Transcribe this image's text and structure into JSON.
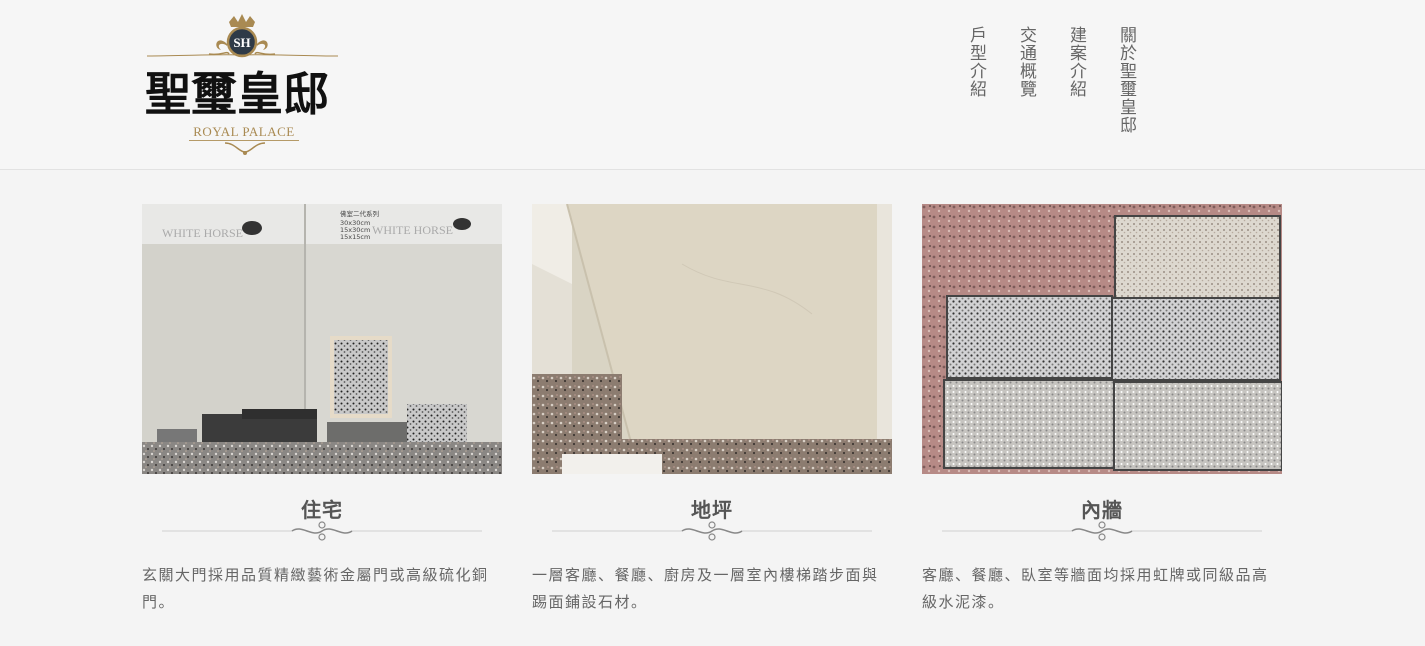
{
  "brand": {
    "monogram": "SH",
    "name": "聖璽皇邸",
    "subtitle": "ROYAL PALACE",
    "gold_color": "#a98a52"
  },
  "nav": [
    {
      "label": "戶型介紹"
    },
    {
      "label": "交通概覽"
    },
    {
      "label": "建案介紹"
    },
    {
      "label": "關於聖璽皇邸"
    }
  ],
  "cards": [
    {
      "title": "住宅",
      "description": "玄關大門採用品質精緻藝術金屬門或高級硫化銅門。",
      "photo_text": {
        "a": "WHITE HORSE",
        "b": "WHITE HORSE",
        "series": "佛室二代系列",
        "sizes": [
          "30x30cm",
          "15x30cm",
          "15x15cm"
        ]
      }
    },
    {
      "title": "地坪",
      "description": "一層客廳、餐廳、廚房及一層室內樓梯踏步面與踢面鋪設石材。"
    },
    {
      "title": "內牆",
      "description": "客廳、餐廳、臥室等牆面均採用虹牌或同級品高級水泥漆。"
    }
  ]
}
